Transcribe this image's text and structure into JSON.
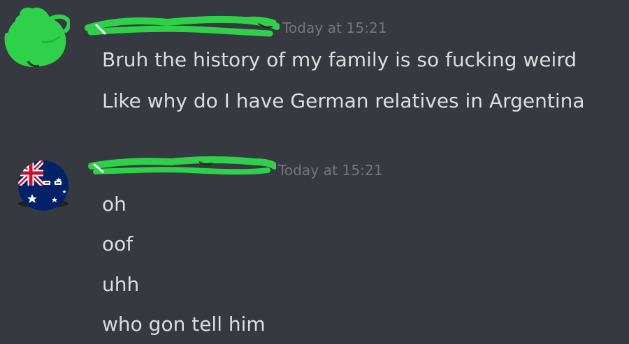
{
  "messages": [
    {
      "author_redacted": true,
      "avatar": "redacted-green-scribble-avatar",
      "timestamp": "Today at 15:21",
      "lines": [
        "Bruh the history of my family is so fucking weird",
        "Like why do I have German relatives in Argentina"
      ]
    },
    {
      "author_redacted": true,
      "avatar": "australia-countryball-avatar",
      "timestamp": "Today at 15:21",
      "lines": [
        "oh",
        "oof",
        "uhh",
        "who gon tell him"
      ]
    }
  ],
  "colors": {
    "background": "#36393f",
    "text": "#dcddde",
    "timestamp": "#72767d",
    "redaction_green": "#2fd14a"
  }
}
